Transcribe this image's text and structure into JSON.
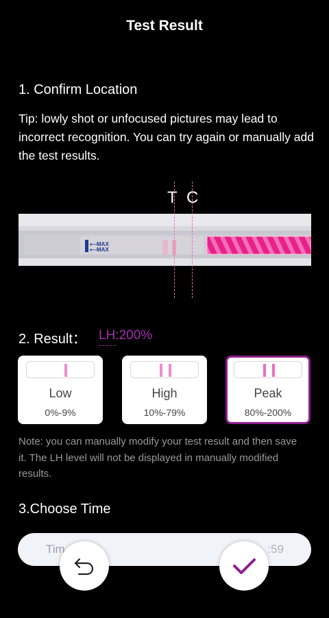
{
  "header": {
    "title": "Test Result"
  },
  "confirm_location": {
    "heading": "1. Confirm Location",
    "tip": "Tip: lowly shot or unfocused pictures may lead to incorrect recognition. You can try again or manually add the test results.",
    "t_label": "T",
    "c_label": "C",
    "strip": {
      "max_text": "MAX",
      "accent_color": "#e8208a",
      "marker_color": "#e86bb8"
    }
  },
  "result": {
    "heading": "2. Result：",
    "lh_value": "LH:200%",
    "lh_color": "#a52fb0",
    "options": [
      {
        "name": "Low",
        "range": "0%-9%",
        "selected": false
      },
      {
        "name": "High",
        "range": "10%-79%",
        "selected": false
      },
      {
        "name": "Peak",
        "range": "80%-200%",
        "selected": true
      }
    ],
    "selected_border_color": "#8e1e8f"
  },
  "note": "Note: you can manually modify your test result and then save it. The LH level will not be displayed in manually modified results.",
  "choose_time": {
    "heading": "3.Choose Time",
    "field_label": "Tim",
    "field_value": ":59"
  },
  "actions": {
    "back_icon": "undo-arrow-icon",
    "confirm_icon": "checkmark-icon",
    "confirm_color": "#8e1e8f"
  }
}
